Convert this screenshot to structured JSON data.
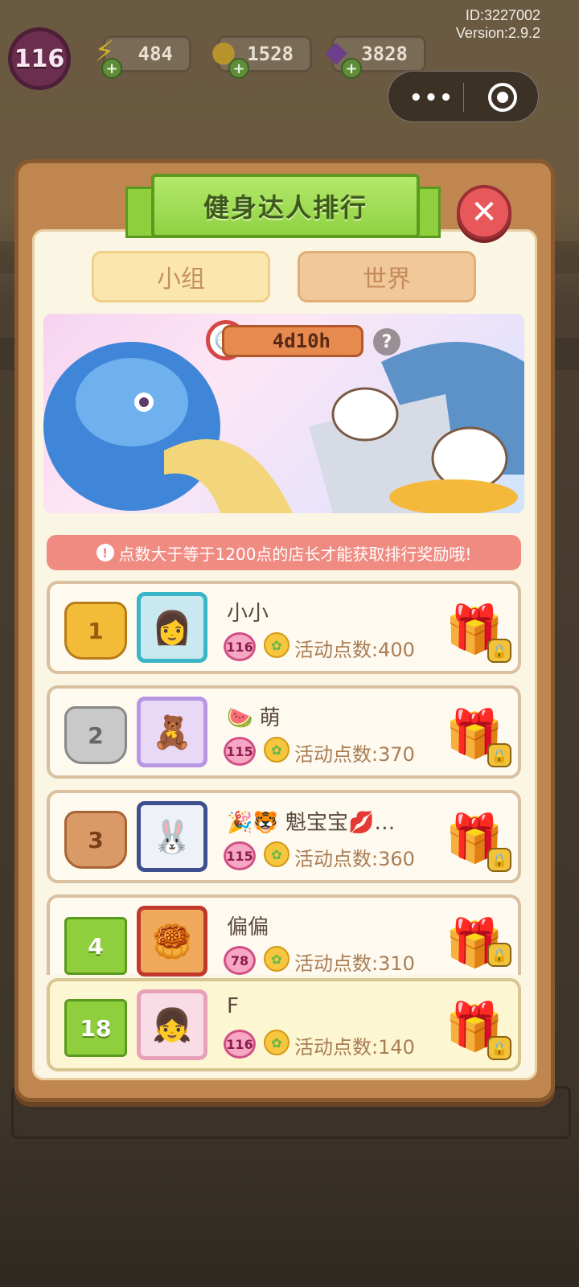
{
  "hud": {
    "level": "116",
    "energy": "484",
    "coins": "1528",
    "gems": "3828",
    "id_text": "ID:3227002",
    "version_text": "Version:2.9.2"
  },
  "capsule": {
    "more_icon": "more-dots-icon",
    "close_icon": "target-icon"
  },
  "panel": {
    "title": "健身达人排行",
    "tabs": [
      {
        "label": "小组"
      },
      {
        "label": "世界"
      }
    ],
    "timer": "4d10h",
    "help": "?",
    "notice": "点数大于等于1200点的店长才能获取排行奖励哦!"
  },
  "rows": [
    {
      "rank": "1",
      "name": "小小",
      "level": "116",
      "points": "活动点数:400",
      "avatar": "👩",
      "gift": "🎁"
    },
    {
      "rank": "2",
      "name": "🍉 萌",
      "level": "115",
      "points": "活动点数:370",
      "avatar": "🧸",
      "gift": "🎁"
    },
    {
      "rank": "3",
      "name": "🎉🐯 魁宝宝💋…",
      "level": "115",
      "points": "活动点数:360",
      "avatar": "🐰",
      "gift": "🎁"
    },
    {
      "rank": "4",
      "name": "偏偏",
      "level": "78",
      "points": "活动点数:310",
      "avatar": "🥮",
      "gift": "🎁"
    }
  ],
  "me": {
    "rank": "18",
    "name": "F",
    "level": "116",
    "points": "活动点数:140",
    "avatar": "👧",
    "gift": "🎁"
  },
  "colors": {
    "panel": "#c08650",
    "accent_green": "#8fcf3e",
    "notice": "#f08b82",
    "close": "#e8585a"
  }
}
